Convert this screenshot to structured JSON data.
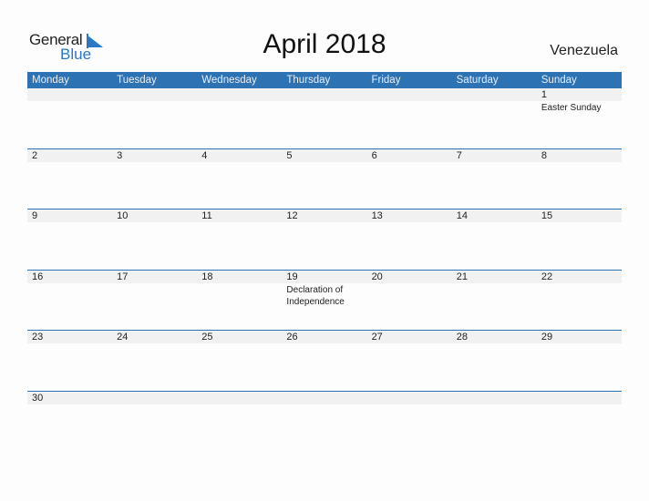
{
  "logo": {
    "general": "General",
    "blue": "Blue"
  },
  "title": "April 2018",
  "country": "Venezuela",
  "weekdays": [
    "Monday",
    "Tuesday",
    "Wednesday",
    "Thursday",
    "Friday",
    "Saturday",
    "Sunday"
  ],
  "weeks": [
    [
      {
        "day": ""
      },
      {
        "day": ""
      },
      {
        "day": ""
      },
      {
        "day": ""
      },
      {
        "day": ""
      },
      {
        "day": ""
      },
      {
        "day": "1",
        "holiday": "Easter Sunday"
      }
    ],
    [
      {
        "day": "2"
      },
      {
        "day": "3"
      },
      {
        "day": "4"
      },
      {
        "day": "5"
      },
      {
        "day": "6"
      },
      {
        "day": "7"
      },
      {
        "day": "8"
      }
    ],
    [
      {
        "day": "9"
      },
      {
        "day": "10"
      },
      {
        "day": "11"
      },
      {
        "day": "12"
      },
      {
        "day": "13"
      },
      {
        "day": "14"
      },
      {
        "day": "15"
      }
    ],
    [
      {
        "day": "16"
      },
      {
        "day": "17"
      },
      {
        "day": "18"
      },
      {
        "day": "19",
        "holiday": "Declaration of Independence"
      },
      {
        "day": "20"
      },
      {
        "day": "21"
      },
      {
        "day": "22"
      }
    ],
    [
      {
        "day": "23"
      },
      {
        "day": "24"
      },
      {
        "day": "25"
      },
      {
        "day": "26"
      },
      {
        "day": "27"
      },
      {
        "day": "28"
      },
      {
        "day": "29"
      }
    ],
    [
      {
        "day": "30"
      },
      {
        "day": ""
      },
      {
        "day": ""
      },
      {
        "day": ""
      },
      {
        "day": ""
      },
      {
        "day": ""
      },
      {
        "day": ""
      }
    ]
  ]
}
